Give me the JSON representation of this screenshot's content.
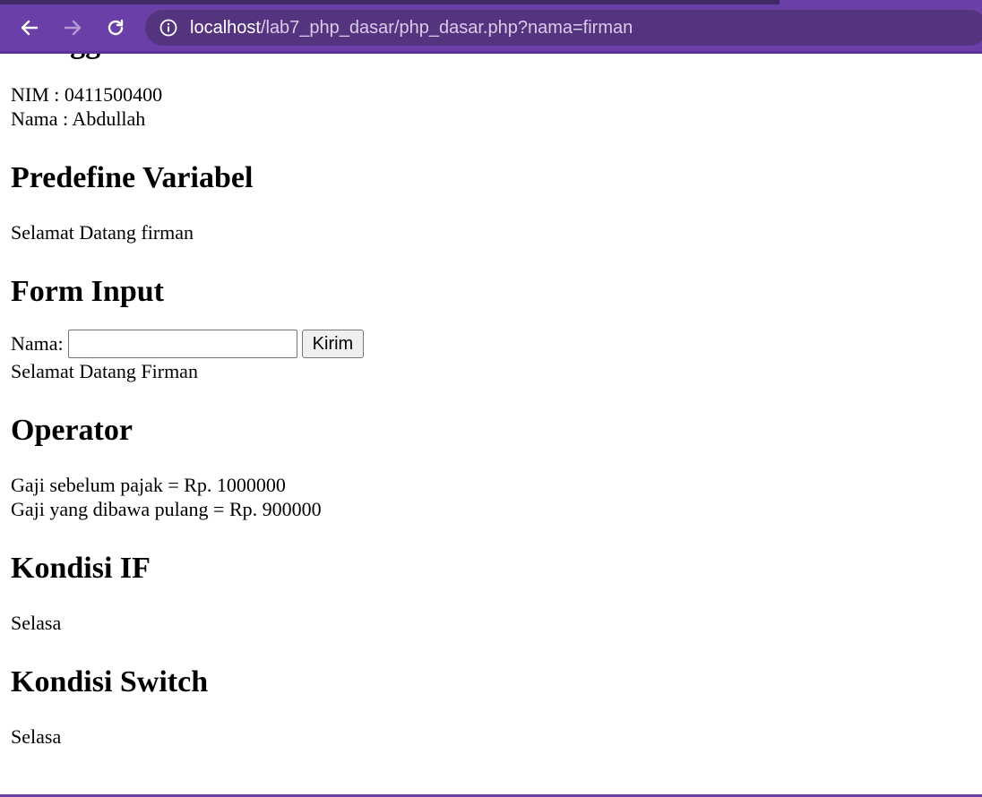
{
  "browser": {
    "url_host": "localhost",
    "url_path": "/lab7_php_dasar/php_dasar.php?nama=firman",
    "accent_color": "#6a3fa8",
    "icons": [
      "back-arrow-icon",
      "forward-arrow-icon",
      "reload-icon",
      "info-icon"
    ]
  },
  "page": {
    "sections": {
      "variabel": {
        "heading": "Menggunakan Variabel",
        "nim": "NIM : 0411500400",
        "nama": "Nama : Abdullah"
      },
      "predefine": {
        "heading": "Predefine Variabel",
        "text": "Selamat Datang firman"
      },
      "form": {
        "heading": "Form Input",
        "label": "Nama:",
        "input_value": "",
        "button_label": "Kirim",
        "result": "Selamat Datang Firman"
      },
      "operator": {
        "heading": "Operator",
        "line1": "Gaji sebelum pajak = Rp. 1000000",
        "line2": "Gaji yang dibawa pulang = Rp. 900000"
      },
      "kondisi_if": {
        "heading": "Kondisi IF",
        "text": "Selasa"
      },
      "kondisi_switch": {
        "heading": "Kondisi Switch",
        "text": "Selasa"
      }
    }
  }
}
